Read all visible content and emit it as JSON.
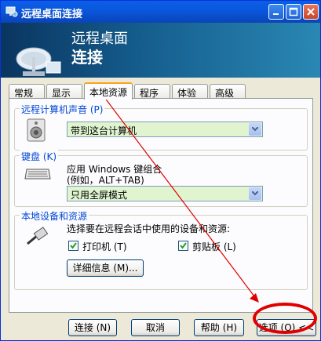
{
  "window": {
    "title": "远程桌面连接"
  },
  "banner": {
    "line1": "远程桌面",
    "line2": "连接"
  },
  "tabs": [
    {
      "label": "常规"
    },
    {
      "label": "显示"
    },
    {
      "label": "本地资源",
      "active": true
    },
    {
      "label": "程序"
    },
    {
      "label": "体验"
    },
    {
      "label": "高级"
    }
  ],
  "sound": {
    "legend": "远程计算机声音 (P)",
    "selected": "带到这台计算机"
  },
  "keyboard": {
    "legend": "键盘 (K)",
    "desc1": "应用 Windows 键组合",
    "desc2": "(例如，ALT+TAB)",
    "selected": "只用全屏模式"
  },
  "devices": {
    "legend": "本地设备和资源",
    "desc": "选择要在远程会话中使用的设备和资源:",
    "printer_label": "打印机 (T)",
    "clipboard_label": "剪贴板 (L)",
    "printer_checked": true,
    "clipboard_checked": true,
    "details_button": "详细信息 (M)..."
  },
  "footer": {
    "connect": "连接 (N)",
    "cancel": "取消",
    "help": "帮助 (H)",
    "options": "选项 (O) <<"
  },
  "annotation": {
    "color": "#e00000"
  }
}
